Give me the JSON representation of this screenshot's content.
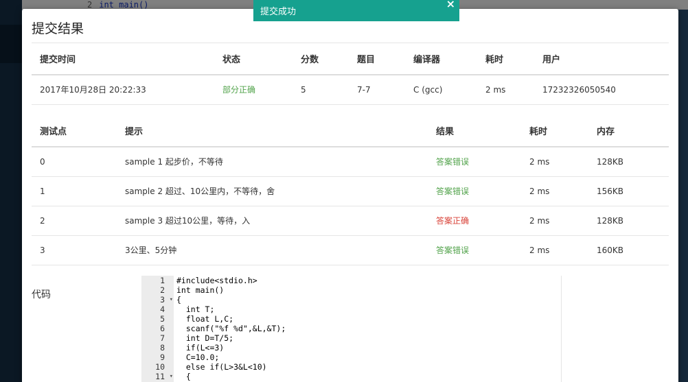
{
  "background": {
    "code_line_number": "2",
    "code_line": "int main()"
  },
  "toast": {
    "message": "提交成功",
    "close": "×"
  },
  "modal": {
    "title": "提交结果",
    "summary": {
      "headers": [
        "提交时间",
        "状态",
        "分数",
        "题目",
        "编译器",
        "耗时",
        "用户"
      ],
      "row": {
        "time": "2017年10月28日 20:22:33",
        "status": "部分正确",
        "score": "5",
        "problem": "7-7",
        "compiler": "C (gcc)",
        "duration": "2 ms",
        "user": "17232326050540"
      }
    },
    "tests": {
      "headers": [
        "测试点",
        "提示",
        "结果",
        "耗时",
        "内存"
      ],
      "rows": [
        {
          "id": "0",
          "hint": "sample 1 起步价，不等待",
          "result": "答案错误",
          "time": "2 ms",
          "memory": "128KB"
        },
        {
          "id": "1",
          "hint": "sample 2 超过、10公里内，不等待，舍",
          "result": "答案错误",
          "time": "2 ms",
          "memory": "156KB"
        },
        {
          "id": "2",
          "hint": "sample 3 超过10公里，等待，入",
          "result": "答案正确",
          "time": "2 ms",
          "memory": "128KB"
        },
        {
          "id": "3",
          "hint": "3公里、5分钟",
          "result": "答案错误",
          "time": "2 ms",
          "memory": "160KB"
        }
      ]
    },
    "code_label": "代码",
    "code": {
      "line_numbers": [
        "1",
        "2",
        "3",
        "4",
        "5",
        "6",
        "7",
        "8",
        "9",
        "10",
        "11"
      ],
      "lines": [
        "#include<stdio.h>",
        "int main()",
        "{",
        "  int T;",
        "  float L,C;",
        "  scanf(\"%f %d\",&L,&T);",
        "  int D=T/5;",
        "  if(L<=3)",
        "  C=10.0;",
        "  else if(L>3&L<10)",
        "  {"
      ]
    }
  },
  "colors": {
    "toast_bg": "#16a18f",
    "correct": "#52a34b",
    "wrong": "#d9443a"
  }
}
